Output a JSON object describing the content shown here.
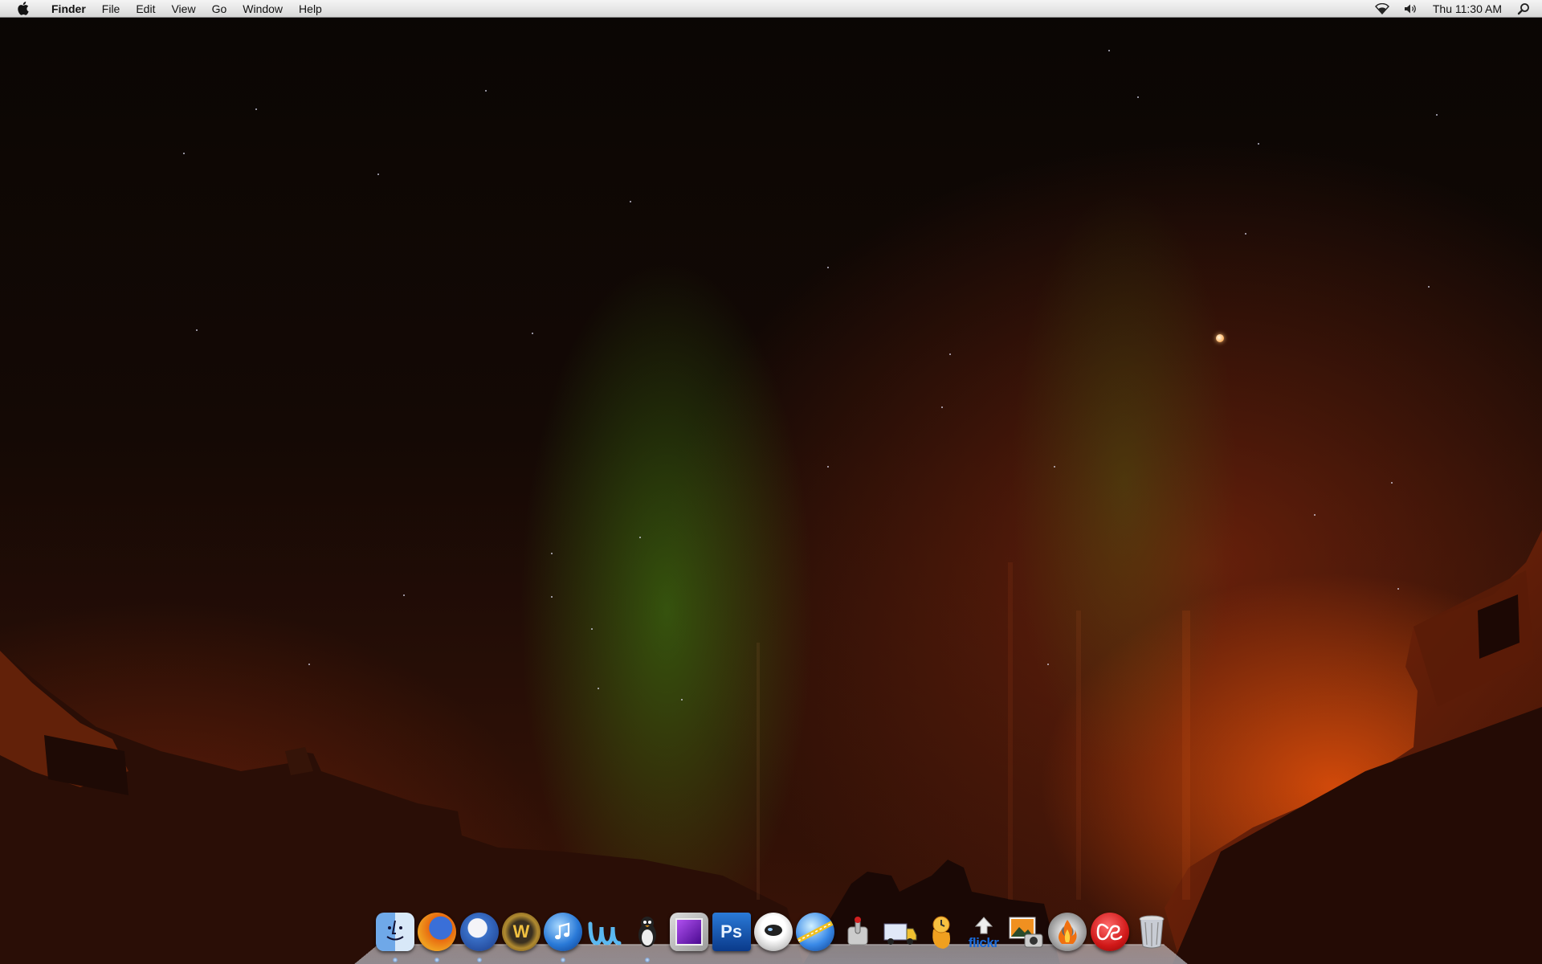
{
  "menubar": {
    "app_name": "Finder",
    "menus": [
      "File",
      "Edit",
      "View",
      "Go",
      "Window",
      "Help"
    ],
    "clock": "Thu 11:30 AM",
    "status_icons": [
      "wifi-icon",
      "volume-icon",
      "spotlight-icon"
    ]
  },
  "dock": {
    "items": [
      {
        "name": "finder",
        "icon": "finder-icon",
        "running": true
      },
      {
        "name": "firefox",
        "icon": "firefox-icon",
        "running": true
      },
      {
        "name": "thunderbird",
        "icon": "thunderbird-icon",
        "running": true
      },
      {
        "name": "world-of-warcraft",
        "icon": "warcraft-icon",
        "glyph": "W",
        "running": false
      },
      {
        "name": "itunes",
        "icon": "itunes-icon",
        "running": true
      },
      {
        "name": "wavelength-app",
        "icon": "wave-app-icon",
        "running": false
      },
      {
        "name": "adium",
        "icon": "penguin-icon",
        "running": true
      },
      {
        "name": "purple-app",
        "icon": "purple-square-icon",
        "running": false
      },
      {
        "name": "photoshop",
        "icon": "photoshop-icon",
        "glyph": "Ps",
        "running": false
      },
      {
        "name": "astronaut-app",
        "icon": "astronaut-icon",
        "running": false
      },
      {
        "name": "web-globe-app",
        "icon": "globe-icon",
        "running": false
      },
      {
        "name": "system-preferences",
        "icon": "switch-icon",
        "running": false
      },
      {
        "name": "transmit",
        "icon": "truck-icon",
        "running": false
      },
      {
        "name": "growl-app",
        "icon": "clock-bird-icon",
        "running": false
      },
      {
        "name": "flickr-uploadr",
        "icon": "flickr-icon",
        "glyph": "flickr",
        "running": false
      },
      {
        "name": "iphoto",
        "icon": "iphoto-icon",
        "running": false
      },
      {
        "name": "burn-app",
        "icon": "flame-icon",
        "running": false
      },
      {
        "name": "lastfm",
        "icon": "lastfm-icon",
        "running": false
      },
      {
        "name": "trash",
        "icon": "trash-icon",
        "running": false
      }
    ]
  },
  "colors": {
    "menubar_bg": "#e6e6e6",
    "sky_dark": "#0a0604",
    "aurora_green": "#46881a",
    "glow_orange": "#ff5a0a"
  }
}
